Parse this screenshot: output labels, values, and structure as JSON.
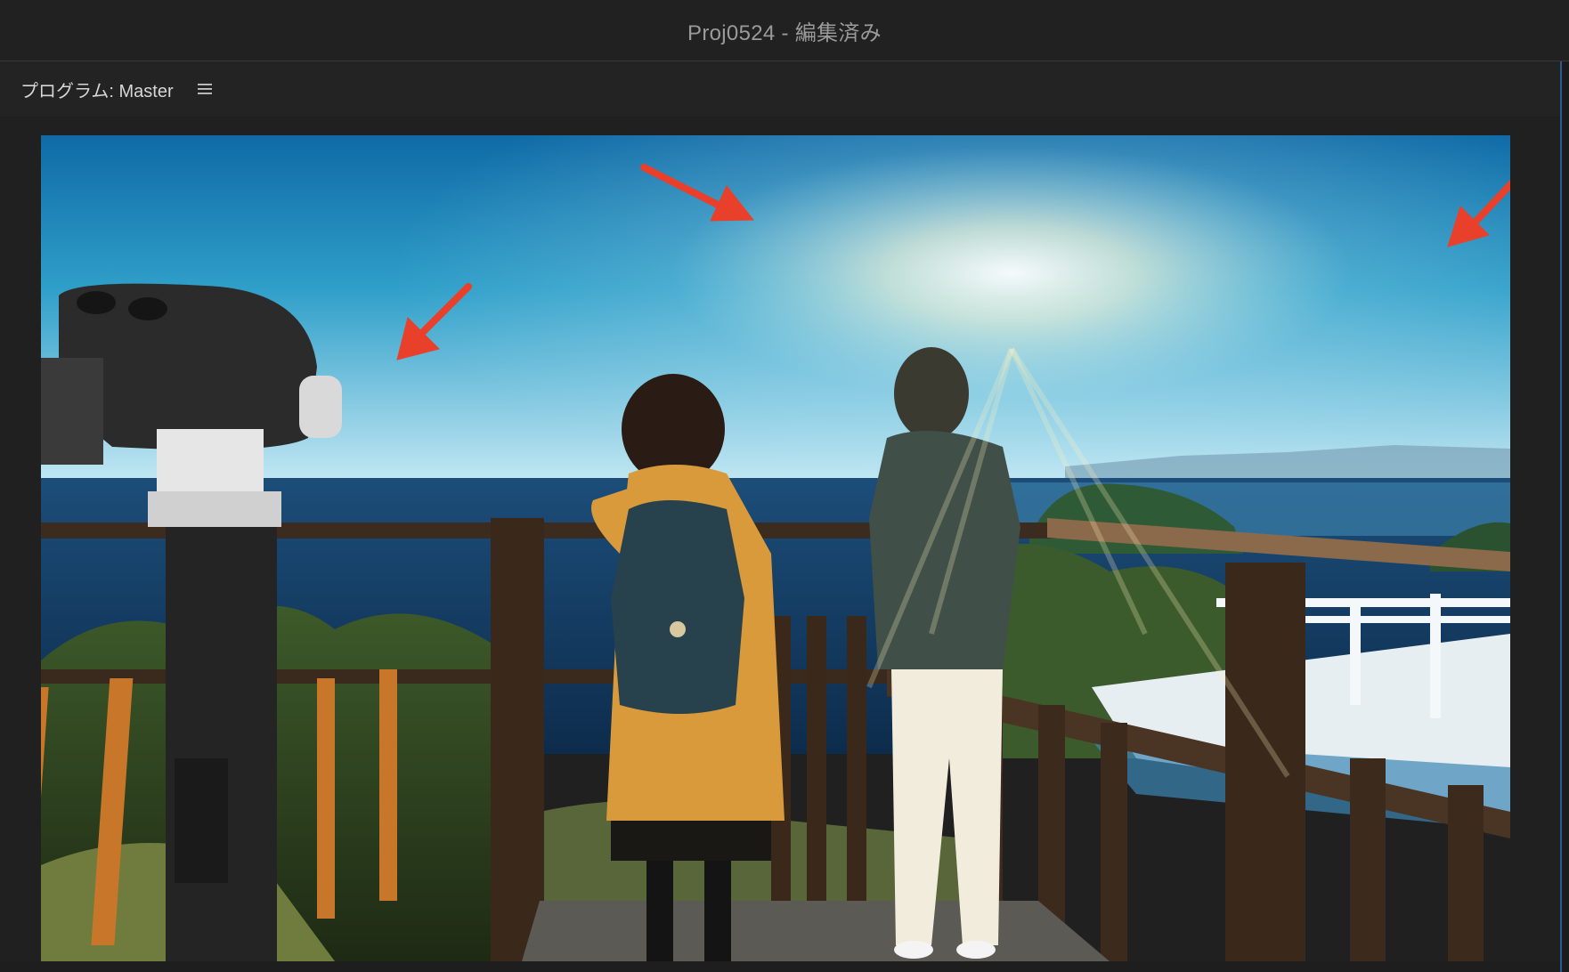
{
  "window": {
    "title": "Proj0524 - 編集済み"
  },
  "panel": {
    "title": "プログラム: Master",
    "menu_icon": "hamburger-menu-icon"
  },
  "program_monitor": {
    "frame_content": "video-frame",
    "annotations": [
      "red-arrow-icon",
      "red-arrow-icon",
      "red-arrow-icon"
    ]
  },
  "colors": {
    "arrow": "#e8402a",
    "background": "#232323",
    "title_text": "#9a9a9a",
    "panel_text": "#d6d6d6"
  }
}
